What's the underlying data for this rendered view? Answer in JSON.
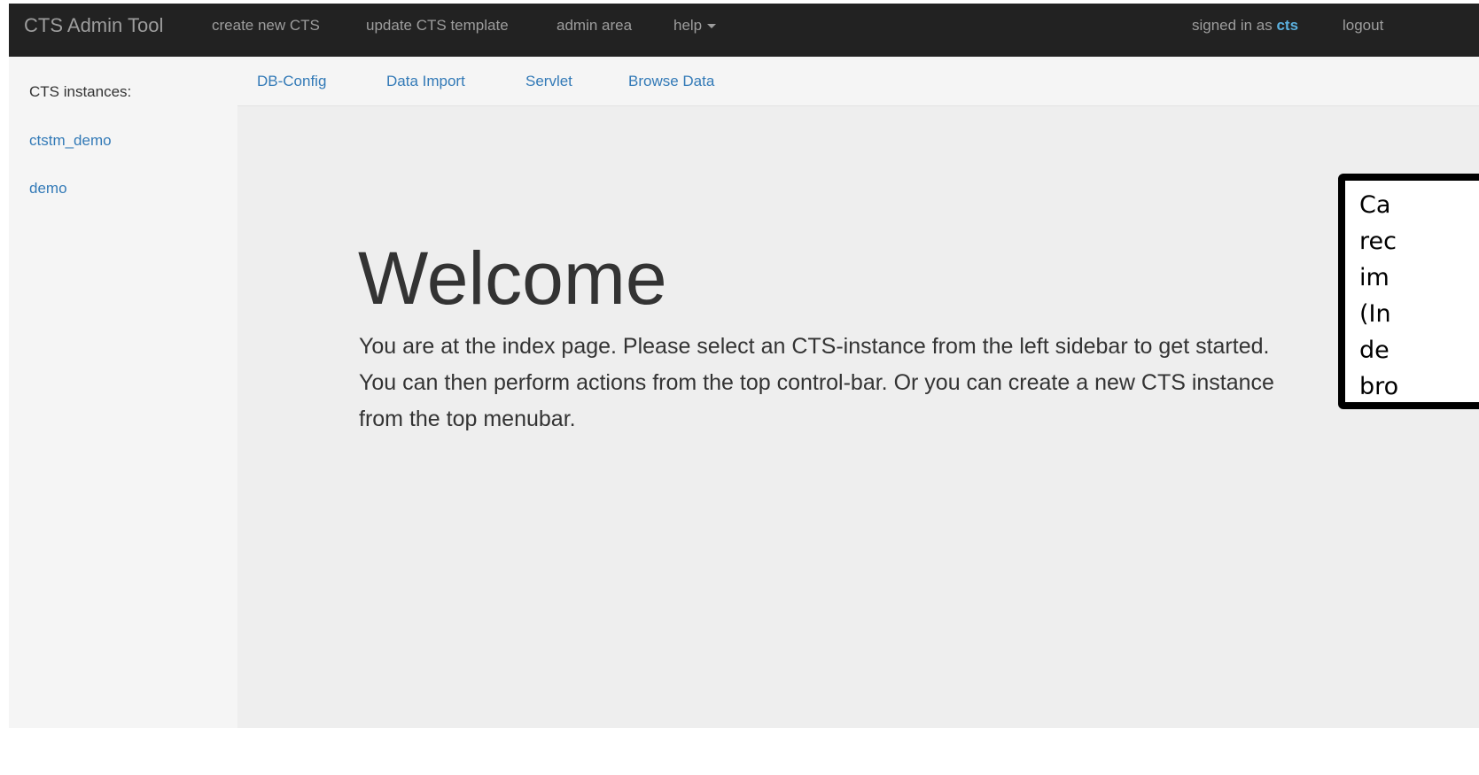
{
  "navbar": {
    "brand": "CTS Admin Tool",
    "items": [
      {
        "label": "create new CTS"
      },
      {
        "label": "update CTS template"
      },
      {
        "label": "admin area"
      },
      {
        "label": "help"
      }
    ],
    "signed_in_prefix": "signed in as ",
    "username": "cts",
    "logout": "logout"
  },
  "sidebar": {
    "header": "CTS instances:",
    "items": [
      {
        "label": "ctstm_demo"
      },
      {
        "label": "demo"
      }
    ]
  },
  "control_bar": {
    "items": [
      {
        "label": "DB-Config"
      },
      {
        "label": "Data Import"
      },
      {
        "label": "Servlet"
      },
      {
        "label": "Browse Data"
      }
    ]
  },
  "content": {
    "title": "Welcome",
    "text": "You are at the index page. Please select an CTS-instance from the left sidebar to get started. You can then perform actions from the top control-bar. Or you can create a new CTS instance from the top menubar."
  },
  "caption_box": {
    "lines": [
      "Ca",
      "rec",
      "im",
      "(In",
      "de",
      "bro"
    ]
  },
  "colors": {
    "navbar_bg": "#222222",
    "navbar_text": "#9d9d9d",
    "link": "#337ab7",
    "username": "#5bb0de",
    "main_bg": "#eeeeee",
    "sidebar_bg": "#f5f5f5"
  }
}
